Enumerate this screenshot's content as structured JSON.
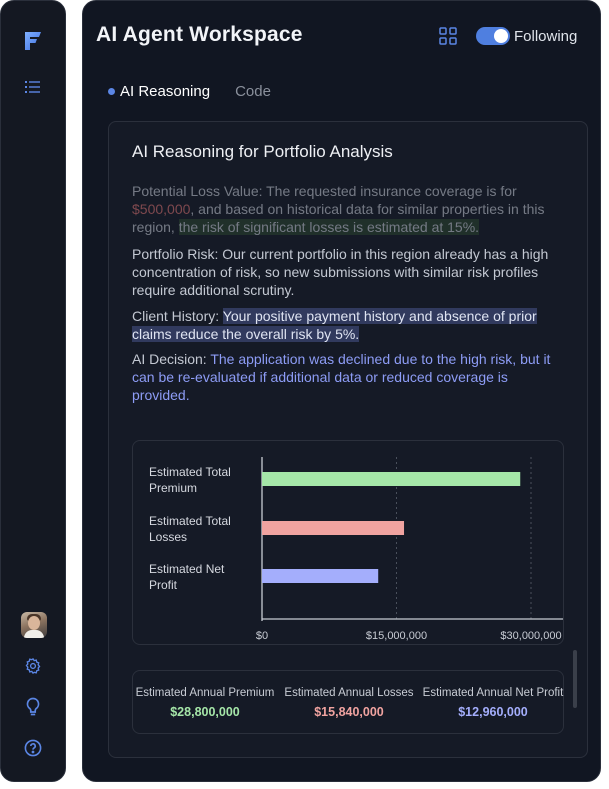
{
  "app": {
    "logo_letter": "F"
  },
  "sidebar": {
    "icons": [
      "logo-icon",
      "list-icon",
      "avatar",
      "gear-icon",
      "lightbulb-icon",
      "help-icon"
    ]
  },
  "header": {
    "title": "AI Agent Workspace",
    "toggle_label": "Following",
    "toggle_on": true
  },
  "tabs": [
    {
      "label": "AI Reasoning",
      "active": true
    },
    {
      "label": "Code",
      "active": false
    }
  ],
  "card": {
    "title": "AI Reasoning for Portfolio Analysis",
    "p1": {
      "prefix": "Potential Loss Value: The requested insurance coverage is for ",
      "amount": "$500,000",
      "middle": ", and based on historical data for similar properties in this region, ",
      "highlight": "the risk of significant losses is estimated at 15%."
    },
    "p2": "Portfolio Risk: Our current portfolio in this region already has a high concentration of risk, so new submissions with similar risk profiles require additional scrutiny.",
    "p3": {
      "prefix": "Client History: ",
      "highlight": "Your positive payment history and absence of prior claims reduce the overall risk by 5%."
    },
    "p4": {
      "prefix": "AI Decision: ",
      "decision": "The application was declined due to the high risk, but it can be re-evaluated if additional data or reduced coverage is provided."
    }
  },
  "chart_data": {
    "type": "bar",
    "orientation": "horizontal",
    "categories": [
      "Estimated Total Premium",
      "Estimated Total Losses",
      "Estimated Net Profit"
    ],
    "values": [
      28800000,
      15840000,
      12960000
    ],
    "colors": [
      "#a5e6a8",
      "#f0a3a0",
      "#a4aefc"
    ],
    "xlim": [
      0,
      30000000
    ],
    "xticks": [
      0,
      15000000,
      30000000
    ],
    "xtick_labels": [
      "$0",
      "$15,000,000",
      "$30,000,000"
    ],
    "title": "",
    "xlabel": "",
    "ylabel": ""
  },
  "summary": [
    {
      "label": "Estimated Annual Premium",
      "value": "$28,800,000",
      "color": "#a5e6a8"
    },
    {
      "label": "Estimated Annual Losses",
      "value": "$15,840,000",
      "color": "#f0a3a0"
    },
    {
      "label": "Estimated Annual Net Profit",
      "value": "$12,960,000",
      "color": "#a4aefc"
    }
  ]
}
